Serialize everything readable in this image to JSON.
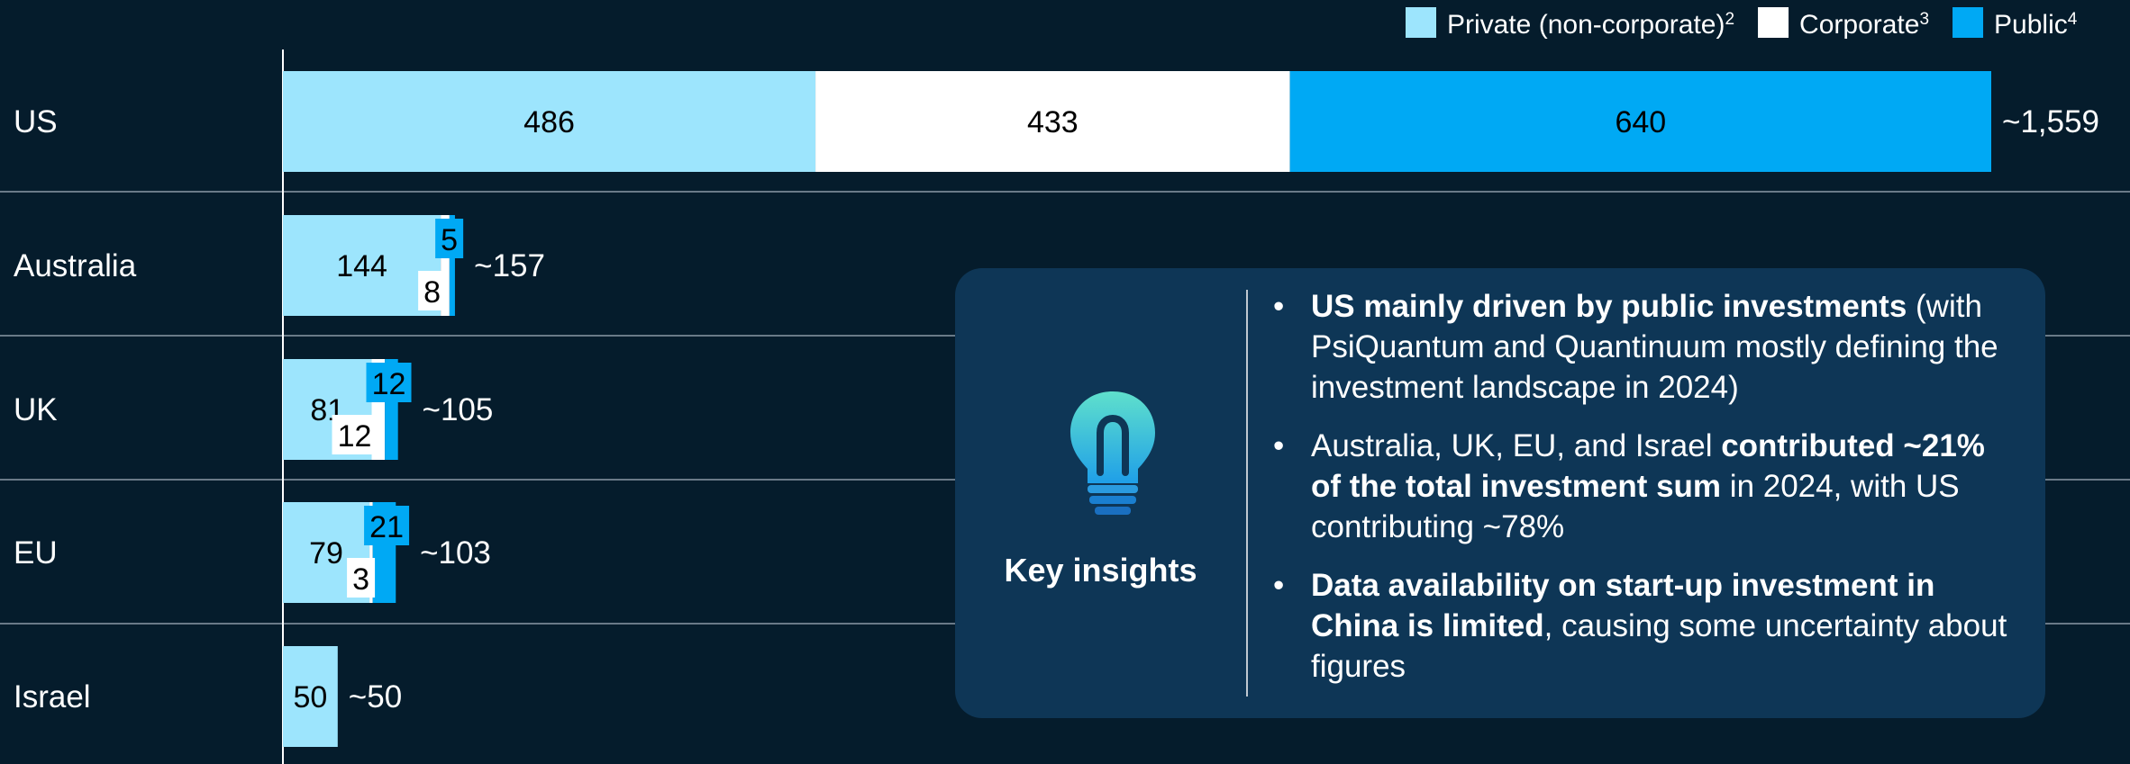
{
  "chart_data": {
    "type": "bar",
    "orientation": "horizontal",
    "stacked": true,
    "categories": [
      "US",
      "Australia",
      "UK",
      "EU",
      "Israel"
    ],
    "series": [
      {
        "name": "Private (non-corporate)",
        "sup": "2",
        "color": "#9de5fd",
        "values": [
          486,
          144,
          81,
          79,
          50
        ]
      },
      {
        "name": "Corporate",
        "sup": "3",
        "color": "#ffffff",
        "values": [
          433,
          8,
          12,
          3,
          0
        ]
      },
      {
        "name": "Public",
        "sup": "4",
        "color": "#00a9f4",
        "values": [
          640,
          5,
          12,
          21,
          0
        ]
      }
    ],
    "totals": [
      "~1,559",
      "~157",
      "~105",
      "~103",
      "~50"
    ],
    "legend_position": "top-right",
    "grid": false
  },
  "insights": {
    "title": "Key insights",
    "icon": "lightbulb-icon",
    "bullets": [
      {
        "parts": [
          {
            "text": "US mainly driven by public investments",
            "bold": true
          },
          {
            "text": " (with PsiQuantum and Quantinuum mostly defining the investment landscape in 2024)",
            "bold": false
          }
        ]
      },
      {
        "parts": [
          {
            "text": "Australia, UK, EU, and Israel ",
            "bold": false
          },
          {
            "text": "contributed ~21% of the total investment sum",
            "bold": true
          },
          {
            "text": " in 2024, with US contributing ~78%",
            "bold": false
          }
        ]
      },
      {
        "parts": [
          {
            "text": "Data availability on start-up investment in China is limited",
            "bold": true
          },
          {
            "text": ", causing some uncertainty about figures",
            "bold": false
          }
        ]
      }
    ]
  },
  "colors": {
    "background": "#051c2c",
    "panel": "#0e3656",
    "private": "#9de5fd",
    "corporate": "#ffffff",
    "public": "#00a9f4"
  }
}
